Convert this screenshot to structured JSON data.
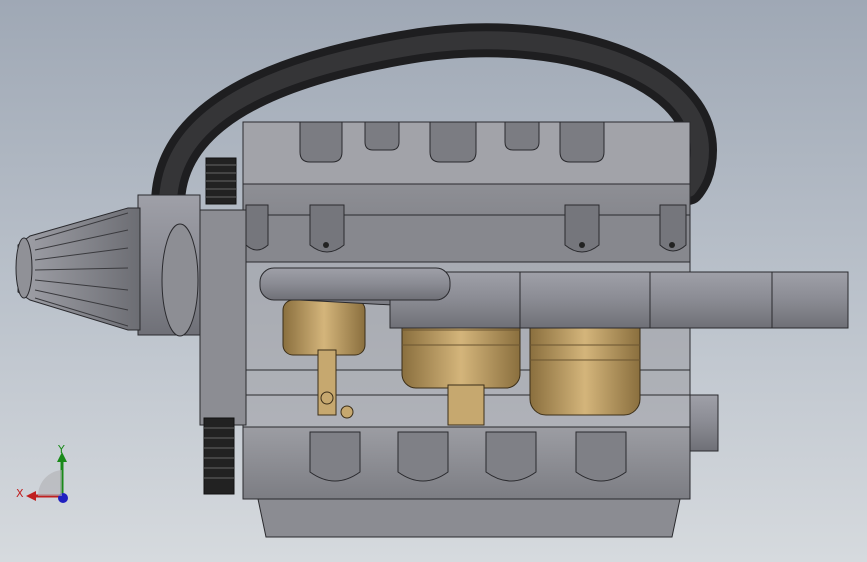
{
  "viewport": {
    "background_top": "#9fa8b5",
    "background_bottom": "#d6dade"
  },
  "model": {
    "body_color": "#8f9096",
    "edge_color": "#2a2a2e",
    "brass_color": "#b99a62",
    "hose_color": "#303032",
    "components": [
      {
        "name": "air-filter-icon"
      },
      {
        "name": "intake-hose-icon"
      },
      {
        "name": "pulley-gear-icon"
      },
      {
        "name": "cylinder-head-icon"
      },
      {
        "name": "engine-block-icon"
      },
      {
        "name": "piston-icon"
      },
      {
        "name": "exhaust-pipe-icon"
      },
      {
        "name": "oil-pan-icon"
      }
    ]
  },
  "triad": {
    "x_label": "X",
    "y_label": "Y",
    "x_color": "#c02020",
    "y_color": "#1a8a1a",
    "z_color": "#2020c0"
  }
}
